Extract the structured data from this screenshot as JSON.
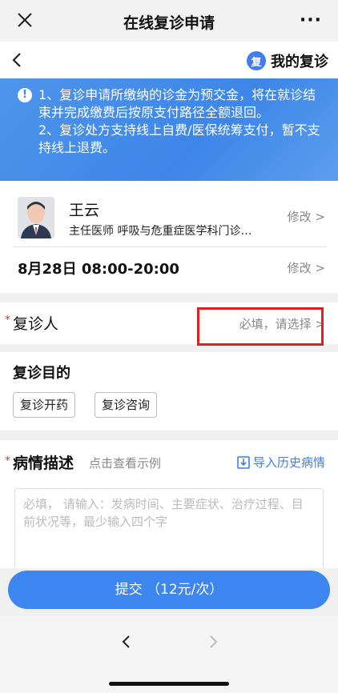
{
  "topbar": {
    "title": "在线复诊申请",
    "more": "···",
    "close_icon": "close-icon"
  },
  "navbar": {
    "back_icon": "chevron-left-icon",
    "badge": "复",
    "mine_label": "我的复诊"
  },
  "notice": {
    "icon": "info-icon",
    "line1": "1、复诊申请所缴纳的诊金为预交金，将在就诊结束并完成缴费后按原支付路径全额退回。",
    "line2": "2、复诊处方支持线上自费/医保统筹支付，暂不支持线上退费。"
  },
  "doctor": {
    "name": "王云",
    "title": "主任医师 呼吸与危重症医学科门诊…",
    "edit_label": "修改 >",
    "schedule": "8月28日 08:00-20:00",
    "schedule_edit_label": "修改 >"
  },
  "patient": {
    "required_mark": "*",
    "label": "复诊人",
    "hint": "必填，请选择 >"
  },
  "purpose": {
    "title": "复诊目的",
    "options": [
      "复诊开药",
      "复诊咨询"
    ]
  },
  "description": {
    "required_mark": "*",
    "title": "病情描述",
    "example_link": "点击查看示例",
    "import_label": "导入历史病情",
    "placeholder": "必填， 请输入：发病时间、主要症状、治疗过程、目前状况等，最少输入四个字"
  },
  "submit": {
    "label": "提交 （12元/次）"
  },
  "browser_nav": {
    "back_icon": "chevron-left-icon",
    "forward_icon": "chevron-right-icon"
  },
  "colors": {
    "accent": "#3d86f0",
    "highlight_box": "#e21f1f",
    "required": "#e53935"
  }
}
